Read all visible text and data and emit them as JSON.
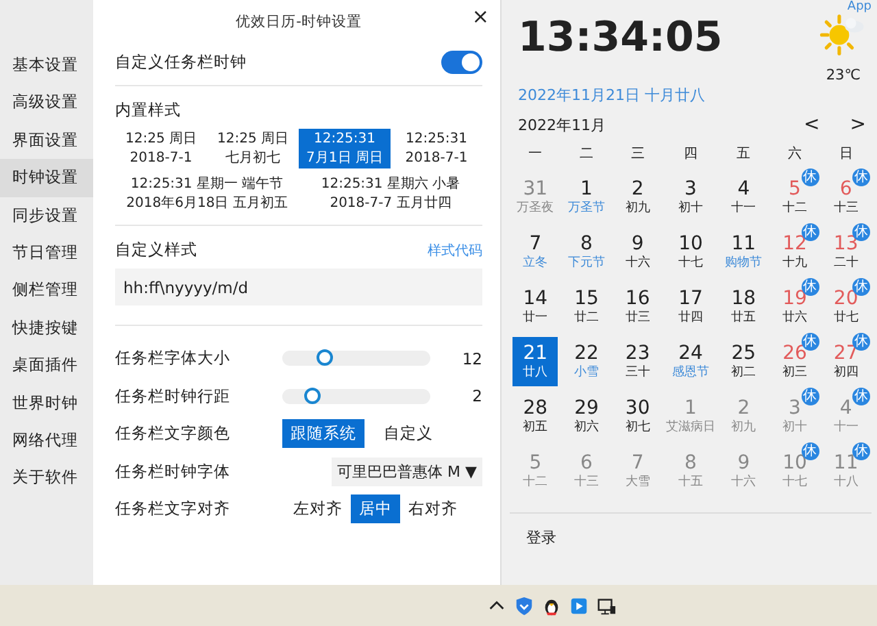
{
  "sidebar": {
    "items": [
      {
        "label": "基本设置",
        "selected": false
      },
      {
        "label": "高级设置",
        "selected": false
      },
      {
        "label": "界面设置",
        "selected": false
      },
      {
        "label": "时钟设置",
        "selected": true
      },
      {
        "label": "同步设置",
        "selected": false
      },
      {
        "label": "节日管理",
        "selected": false
      },
      {
        "label": "侧栏管理",
        "selected": false
      },
      {
        "label": "快捷按键",
        "selected": false
      },
      {
        "label": "桌面插件",
        "selected": false
      },
      {
        "label": "世界时钟",
        "selected": false
      },
      {
        "label": "网络代理",
        "selected": false
      },
      {
        "label": "关于软件",
        "selected": false
      }
    ]
  },
  "settings": {
    "title": "优效日历-时钟设置",
    "close": "×",
    "custom_clock": {
      "label": "自定义任务栏时钟",
      "on": true
    },
    "builtin": {
      "heading": "内置样式",
      "styles": [
        {
          "lines": [
            "12:25 周日",
            "2018-7-1"
          ],
          "selected": false,
          "wide": false
        },
        {
          "lines": [
            "12:25 周日",
            "七月初七"
          ],
          "selected": false,
          "wide": false
        },
        {
          "lines": [
            "12:25:31",
            "7月1日 周日"
          ],
          "selected": true,
          "wide": false
        },
        {
          "lines": [
            "12:25:31",
            "2018-7-1"
          ],
          "selected": false,
          "wide": false
        },
        {
          "lines": [
            "12:25:31 星期一 端午节",
            "2018年6月18日 五月初五"
          ],
          "selected": false,
          "wide": true
        },
        {
          "lines": [
            "12:25:31 星期六 小暑",
            "2018-7-7 五月廿四"
          ],
          "selected": false,
          "wide": true
        }
      ]
    },
    "custom_style": {
      "heading": "自定义样式",
      "link": "样式代码",
      "value": "hh:ff\\nyyyy/m/d"
    },
    "sliders": [
      {
        "label": "任务栏字体大小",
        "level": 0.26,
        "reading": "12"
      },
      {
        "label": "任务栏时钟行距",
        "level": 0.17,
        "reading": "2"
      }
    ],
    "text_color": {
      "label": "任务栏文字颜色",
      "options": [
        {
          "label": "跟随系统",
          "selected": true
        },
        {
          "label": "自定义",
          "selected": false
        }
      ]
    },
    "clock_font": {
      "label": "任务栏时钟字体",
      "value": "可里巴巴普惠体 M",
      "arrow": "▼"
    },
    "text_align": {
      "label": "任务栏文字对齐",
      "options": [
        {
          "label": "左对齐",
          "selected": false
        },
        {
          "label": "居中",
          "selected": true
        },
        {
          "label": "右对齐",
          "selected": false
        }
      ]
    }
  },
  "calendar": {
    "app_link": "App",
    "clock": "13:34:05",
    "date": "2022年11月21日 十月廿八",
    "temperature": "23℃",
    "month": "2022年11月",
    "prev": "<",
    "next": ">",
    "weekdays": [
      "一",
      "二",
      "三",
      "四",
      "五",
      "六",
      "日"
    ],
    "days": [
      {
        "day": "31",
        "lunar": "万圣夜",
        "selected": false,
        "other_month": true,
        "weekend": false,
        "festival": false
      },
      {
        "day": "1",
        "lunar": "万圣节",
        "selected": false,
        "other_month": false,
        "weekend": false,
        "festival": true
      },
      {
        "day": "2",
        "lunar": "初九",
        "selected": false,
        "other_month": false,
        "weekend": false,
        "festival": false
      },
      {
        "day": "3",
        "lunar": "初十",
        "selected": false,
        "other_month": false,
        "weekend": false,
        "festival": false
      },
      {
        "day": "4",
        "lunar": "十一",
        "selected": false,
        "other_month": false,
        "weekend": false,
        "festival": false
      },
      {
        "day": "5",
        "lunar": "十二",
        "selected": false,
        "other_month": false,
        "weekend": true,
        "festival": false,
        "badge": "休"
      },
      {
        "day": "6",
        "lunar": "十三",
        "selected": false,
        "other_month": false,
        "weekend": true,
        "festival": false,
        "badge": "休"
      },
      {
        "day": "7",
        "lunar": "立冬",
        "selected": false,
        "other_month": false,
        "weekend": false,
        "festival": true
      },
      {
        "day": "8",
        "lunar": "下元节",
        "selected": false,
        "other_month": false,
        "weekend": false,
        "festival": true
      },
      {
        "day": "9",
        "lunar": "十六",
        "selected": false,
        "other_month": false,
        "weekend": false,
        "festival": false
      },
      {
        "day": "10",
        "lunar": "十七",
        "selected": false,
        "other_month": false,
        "weekend": false,
        "festival": false
      },
      {
        "day": "11",
        "lunar": "购物节",
        "selected": false,
        "other_month": false,
        "weekend": false,
        "festival": true
      },
      {
        "day": "12",
        "lunar": "十九",
        "selected": false,
        "other_month": false,
        "weekend": true,
        "festival": false,
        "badge": "休"
      },
      {
        "day": "13",
        "lunar": "二十",
        "selected": false,
        "other_month": false,
        "weekend": true,
        "festival": false,
        "badge": "休"
      },
      {
        "day": "14",
        "lunar": "廿一",
        "selected": false,
        "other_month": false,
        "weekend": false,
        "festival": false
      },
      {
        "day": "15",
        "lunar": "廿二",
        "selected": false,
        "other_month": false,
        "weekend": false,
        "festival": false
      },
      {
        "day": "16",
        "lunar": "廿三",
        "selected": false,
        "other_month": false,
        "weekend": false,
        "festival": false
      },
      {
        "day": "17",
        "lunar": "廿四",
        "selected": false,
        "other_month": false,
        "weekend": false,
        "festival": false
      },
      {
        "day": "18",
        "lunar": "廿五",
        "selected": false,
        "other_month": false,
        "weekend": false,
        "festival": false
      },
      {
        "day": "19",
        "lunar": "廿六",
        "selected": false,
        "other_month": false,
        "weekend": true,
        "festival": false,
        "badge": "休"
      },
      {
        "day": "20",
        "lunar": "廿七",
        "selected": false,
        "other_month": false,
        "weekend": true,
        "festival": false,
        "badge": "休"
      },
      {
        "day": "21",
        "lunar": "廿八",
        "selected": true,
        "other_month": false,
        "weekend": false,
        "festival": false
      },
      {
        "day": "22",
        "lunar": "小雪",
        "selected": false,
        "other_month": false,
        "weekend": false,
        "festival": true
      },
      {
        "day": "23",
        "lunar": "三十",
        "selected": false,
        "other_month": false,
        "weekend": false,
        "festival": false
      },
      {
        "day": "24",
        "lunar": "感恩节",
        "selected": false,
        "other_month": false,
        "weekend": false,
        "festival": true
      },
      {
        "day": "25",
        "lunar": "初二",
        "selected": false,
        "other_month": false,
        "weekend": false,
        "festival": false
      },
      {
        "day": "26",
        "lunar": "初三",
        "selected": false,
        "other_month": false,
        "weekend": true,
        "festival": false,
        "badge": "休"
      },
      {
        "day": "27",
        "lunar": "初四",
        "selected": false,
        "other_month": false,
        "weekend": true,
        "festival": false,
        "badge": "休"
      },
      {
        "day": "28",
        "lunar": "初五",
        "selected": false,
        "other_month": false,
        "weekend": false,
        "festival": false
      },
      {
        "day": "29",
        "lunar": "初六",
        "selected": false,
        "other_month": false,
        "weekend": false,
        "festival": false
      },
      {
        "day": "30",
        "lunar": "初七",
        "selected": false,
        "other_month": false,
        "weekend": false,
        "festival": false
      },
      {
        "day": "1",
        "lunar": "艾滋病日",
        "selected": false,
        "other_month": true,
        "weekend": false,
        "festival": false
      },
      {
        "day": "2",
        "lunar": "初九",
        "selected": false,
        "other_month": true,
        "weekend": false,
        "festival": false
      },
      {
        "day": "3",
        "lunar": "初十",
        "selected": false,
        "other_month": true,
        "weekend": false,
        "festival": false,
        "badge": "休"
      },
      {
        "day": "4",
        "lunar": "十一",
        "selected": false,
        "other_month": true,
        "weekend": false,
        "festival": false,
        "badge": "休"
      },
      {
        "day": "5",
        "lunar": "十二",
        "selected": false,
        "other_month": true,
        "weekend": false,
        "festival": false
      },
      {
        "day": "6",
        "lunar": "十三",
        "selected": false,
        "other_month": true,
        "weekend": false,
        "festival": false
      },
      {
        "day": "7",
        "lunar": "大雪",
        "selected": false,
        "other_month": true,
        "weekend": false,
        "festival": false
      },
      {
        "day": "8",
        "lunar": "十五",
        "selected": false,
        "other_month": true,
        "weekend": false,
        "festival": false
      },
      {
        "day": "9",
        "lunar": "十六",
        "selected": false,
        "other_month": true,
        "weekend": false,
        "festival": false
      },
      {
        "day": "10",
        "lunar": "十七",
        "selected": false,
        "other_month": true,
        "weekend": false,
        "festival": false,
        "badge": "休"
      },
      {
        "day": "11",
        "lunar": "十八",
        "selected": false,
        "other_month": true,
        "weekend": false,
        "festival": false,
        "badge": "休"
      }
    ],
    "login": "登录"
  }
}
